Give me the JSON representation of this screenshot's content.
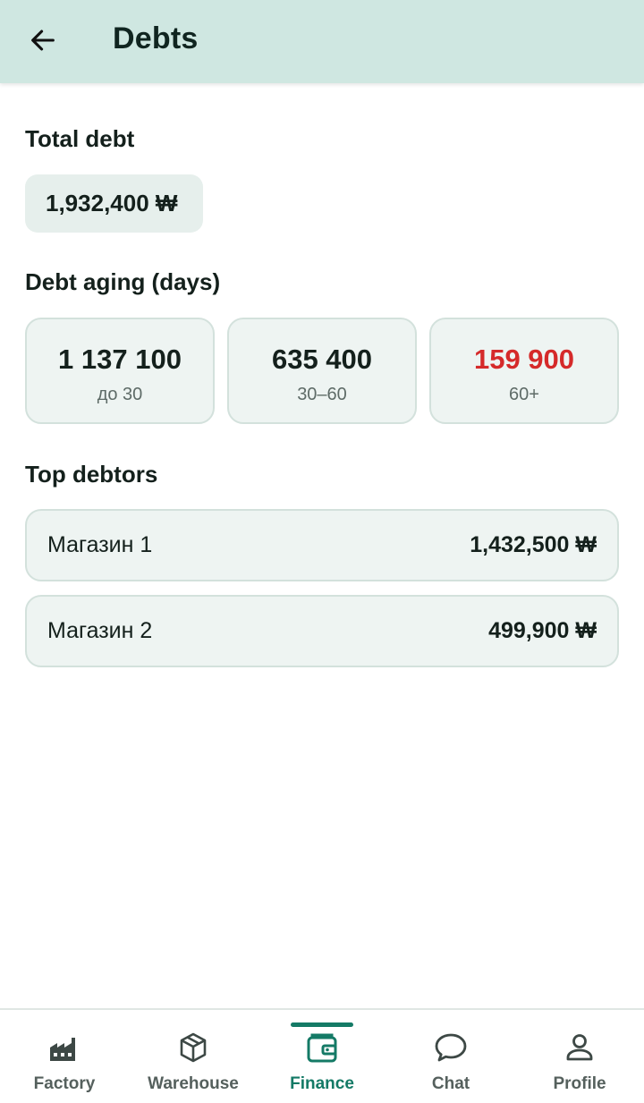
{
  "header": {
    "title": "Debts"
  },
  "total": {
    "title": "Total debt",
    "amount": "1,932,400 ₩"
  },
  "aging": {
    "title": "Debt aging (days)",
    "buckets": [
      {
        "value": "1 137 100",
        "label": "до 30",
        "color": "#14201c"
      },
      {
        "value": "635 400",
        "label": "30–60",
        "color": "#14201c"
      },
      {
        "value": "159 900",
        "label": "60+",
        "color": "#d52a2a"
      }
    ]
  },
  "debtors": {
    "title": "Top debtors",
    "items": [
      {
        "name": "Магазин 1",
        "amount": "1,432,500 ₩"
      },
      {
        "name": "Магазин 2",
        "amount": "499,900 ₩"
      }
    ]
  },
  "nav": {
    "active": "Finance",
    "accent_color": "#147a66",
    "items": [
      {
        "label": "Factory",
        "icon": "factory-icon"
      },
      {
        "label": "Warehouse",
        "icon": "box-icon"
      },
      {
        "label": "Finance",
        "icon": "wallet-icon"
      },
      {
        "label": "Chat",
        "icon": "chat-bubble-icon"
      },
      {
        "label": "Profile",
        "icon": "person-icon"
      }
    ]
  }
}
